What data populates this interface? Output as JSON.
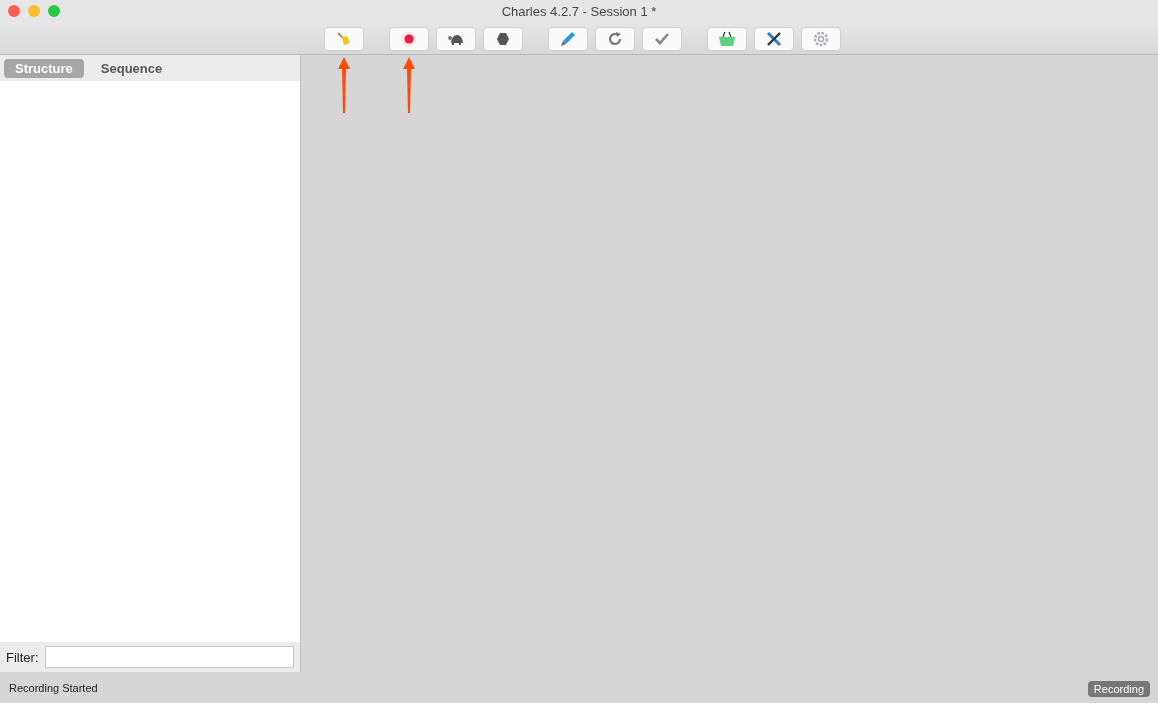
{
  "window": {
    "title": "Charles 4.2.7 - Session 1 *"
  },
  "toolbar": [
    [
      {
        "kind": "broom",
        "annotated": true
      }
    ],
    [
      {
        "kind": "record",
        "annotated": true
      },
      {
        "kind": "turtle",
        "annotated": false
      },
      {
        "kind": "hexagon",
        "annotated": false
      }
    ],
    [
      {
        "kind": "pen",
        "annotated": false
      },
      {
        "kind": "refresh",
        "annotated": false
      },
      {
        "kind": "check",
        "annotated": false
      }
    ],
    [
      {
        "kind": "basket",
        "annotated": false
      },
      {
        "kind": "tools",
        "annotated": false
      },
      {
        "kind": "gear",
        "annotated": false
      }
    ]
  ],
  "tabs": [
    {
      "label": "Structure",
      "selected": true
    },
    {
      "label": "Sequence",
      "selected": false
    }
  ],
  "filter": {
    "label": "Filter:"
  },
  "status_bar": {
    "message": "Recording Started",
    "badge": "Recording"
  }
}
